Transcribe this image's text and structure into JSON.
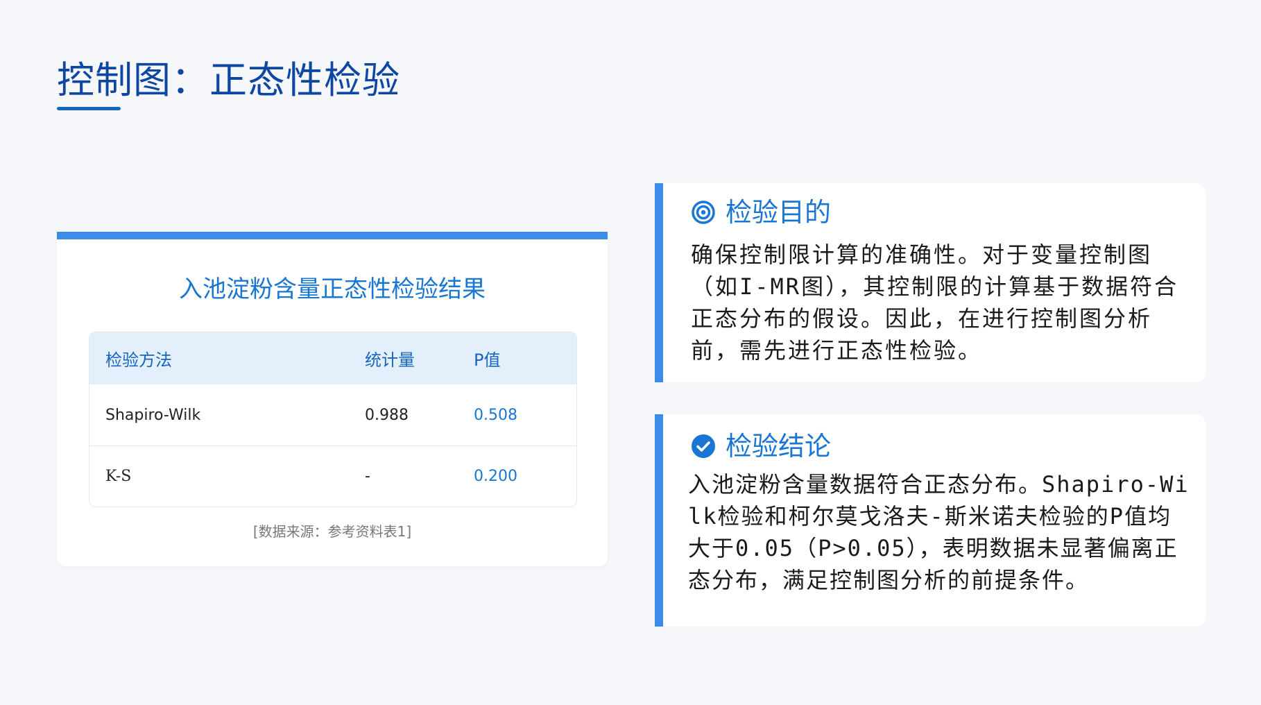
{
  "page": {
    "title": "控制图：正态性检验"
  },
  "table_card": {
    "title": "入池淀粉含量正态性检验结果",
    "columns": [
      "检验方法",
      "统计量",
      "P值"
    ],
    "rows": [
      {
        "method": "Shapiro-Wilk",
        "statistic": "0.988",
        "p_value": "0.508"
      },
      {
        "method": "K-S",
        "statistic": "-",
        "p_value": "0.200"
      }
    ],
    "source": "[数据来源：参考资料表1]"
  },
  "purpose_card": {
    "icon": "target-icon",
    "heading": "检验目的",
    "text": "确保控制限计算的准确性。对于变量控制图（如I-MR图），其控制限的计算基于数据符合正态分布的假设。因此，在进行控制图分析前，需先进行正态性检验。"
  },
  "conclusion_card": {
    "icon": "check-circle-icon",
    "heading": "检验结论",
    "text": "入池淀粉含量数据符合正态分布。Shapiro-Wilk检验和柯尔莫戈洛夫-斯米诺夫检验的P值均大于0.05（P>0.05），表明数据未显著偏离正态分布，满足控制图分析的前提条件。"
  },
  "colors": {
    "accent": "#3b8de8",
    "title": "#0d47a1",
    "link_blue": "#1976d2",
    "header_bg": "#e3f0fc",
    "background": "#f5f7fa"
  }
}
